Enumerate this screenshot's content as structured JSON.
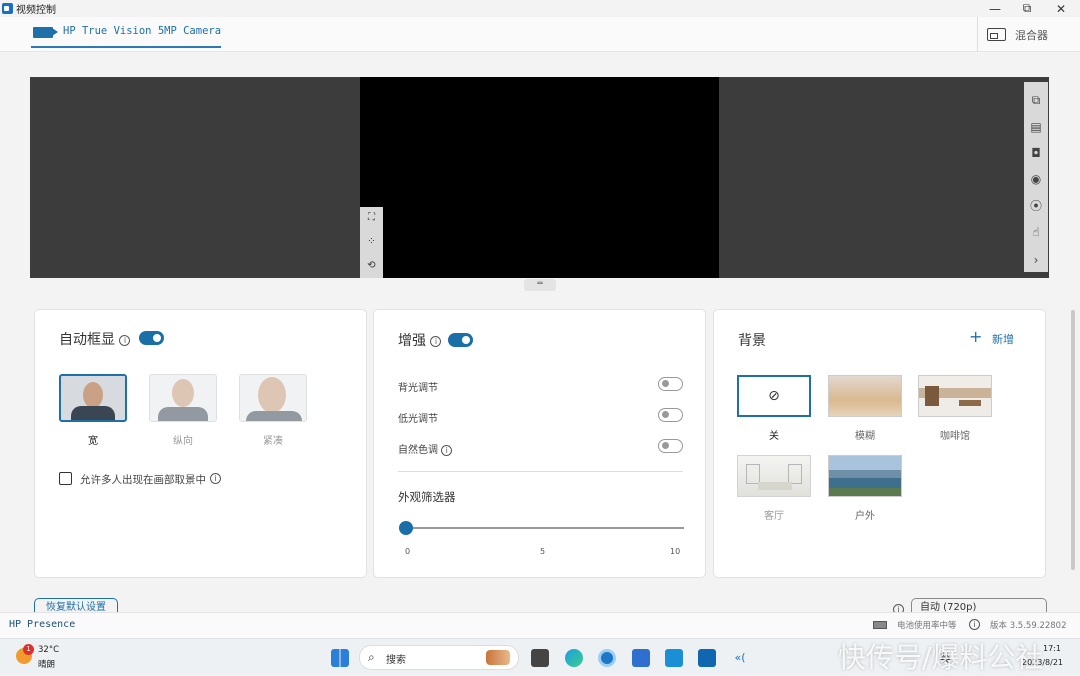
{
  "window": {
    "title": "视频控制",
    "controls": [
      "—",
      "⧉",
      "✕"
    ]
  },
  "header": {
    "camera_tab": "HP True Vision 5MP Camera",
    "mixer_label": "混合器"
  },
  "auto_frame": {
    "title": "自动框显",
    "enabled": true,
    "options": [
      {
        "label": "宽",
        "selected": true
      },
      {
        "label": "纵向",
        "selected": false
      },
      {
        "label": "紧凑",
        "selected": false
      }
    ],
    "multi_person_label": "允许多人出现在画部取景中",
    "multi_person_checked": false
  },
  "enhance": {
    "title": "增强",
    "enabled": true,
    "settings": [
      {
        "label": "背光调节",
        "on": false
      },
      {
        "label": "低光调节",
        "on": false
      },
      {
        "label": "自然色调",
        "on": false
      }
    ],
    "filter_title": "外观筛选器",
    "slider": {
      "value": 0,
      "min_label": "0",
      "mid_label": "5",
      "max_label": "10"
    }
  },
  "background": {
    "title": "背景",
    "add_label": "新增",
    "options": [
      {
        "label": "关",
        "selected": true
      },
      {
        "label": "模糊",
        "selected": false
      },
      {
        "label": "咖啡馆",
        "selected": false
      },
      {
        "label": "客厅",
        "selected": false
      },
      {
        "label": "户外",
        "selected": false
      }
    ]
  },
  "footer": {
    "reset_label": "恢复默认设置",
    "resolution_label": "自动 (720p)"
  },
  "statusbar": {
    "app_name": "HP Presence",
    "battery_text": "电池使用率中等",
    "version": "版本 3.5.59.22802"
  },
  "taskbar": {
    "weather_temp": "32°C",
    "weather_desc": "晴朗",
    "weather_badge": "1",
    "search_placeholder": "搜索",
    "ime": "英",
    "time": "17:1",
    "date": "2023/8/21",
    "watermark": "快传号/爆料公社"
  },
  "colors": {
    "accent": "#1f6fa8",
    "preview_bg": "#3c3c3c",
    "preview_center": "#000000"
  }
}
